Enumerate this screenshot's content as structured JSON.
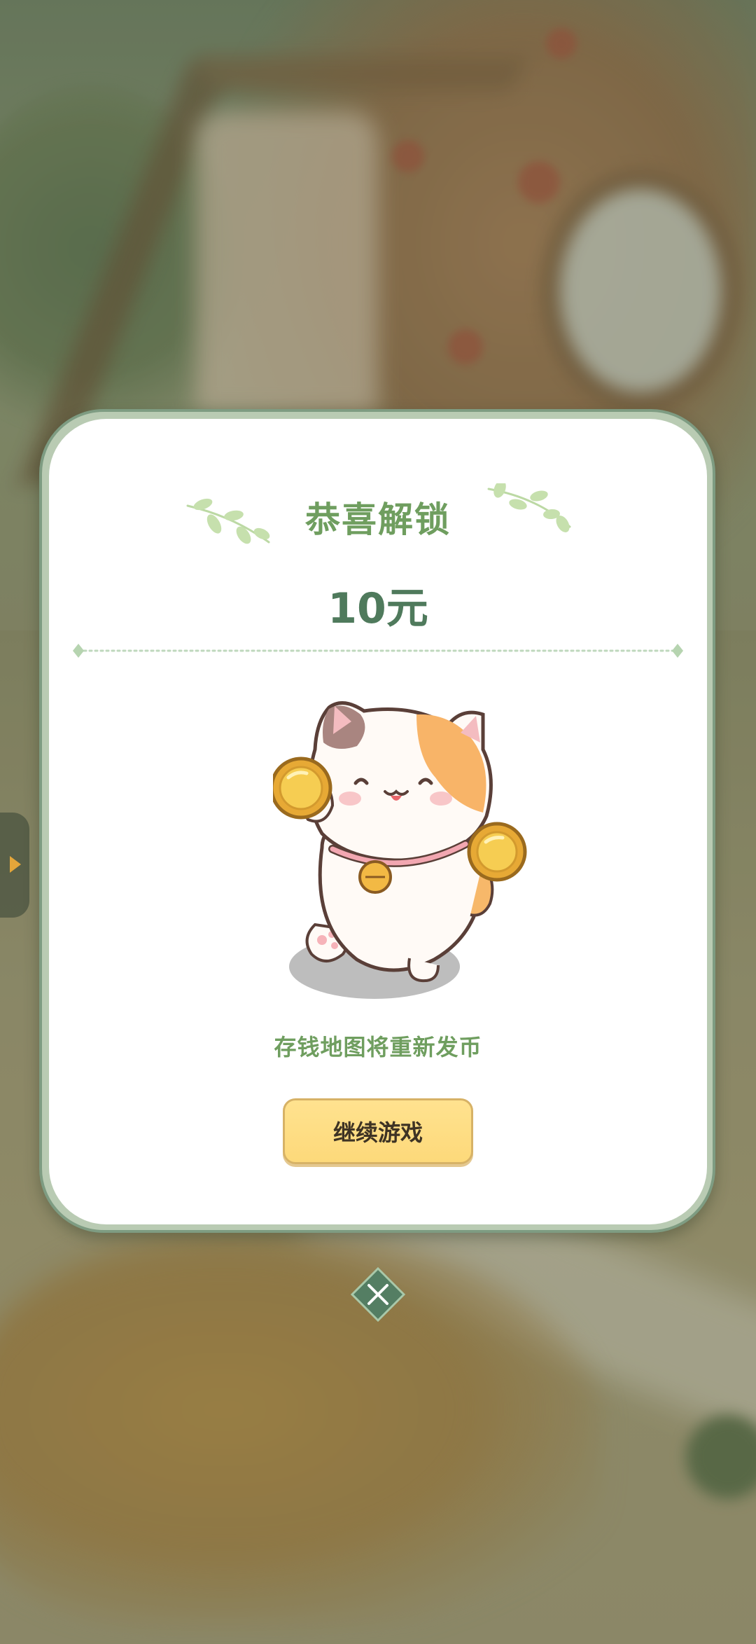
{
  "dialog": {
    "title": "恭喜解锁",
    "amount": "10元",
    "message": "存钱地图将重新发币",
    "continue_button": "继续游戏",
    "close_icon": "close-x-icon"
  },
  "colors": {
    "title_green": "#6f9e5f",
    "amount_green": "#4f7a5c",
    "button_yellow": "#fdd97a",
    "card_border": "#7e9c82"
  }
}
